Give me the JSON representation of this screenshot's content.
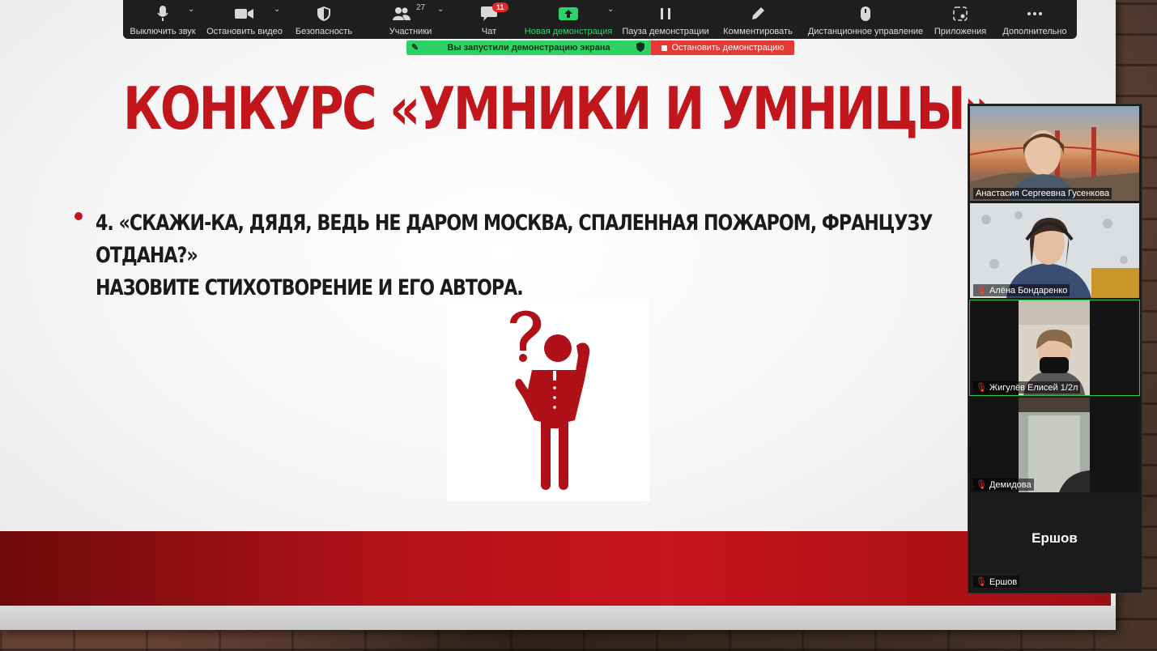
{
  "toolbar": {
    "buttons": [
      {
        "label": "Выключить звук",
        "icon": "microphone-icon"
      },
      {
        "label": "Остановить видео",
        "icon": "video-camera-icon"
      },
      {
        "label": "Безопасность",
        "icon": "shield-icon"
      },
      {
        "label": "Участники",
        "icon": "participants-icon",
        "count": "27"
      },
      {
        "label": "Чат",
        "icon": "chat-icon",
        "badge": "11"
      },
      {
        "label": "Новая демонстрация",
        "icon": "share-screen-icon"
      },
      {
        "label": "Пауза демонстрации",
        "icon": "pause-icon"
      },
      {
        "label": "Комментировать",
        "icon": "pencil-icon"
      },
      {
        "label": "Дистанционное управление",
        "icon": "mouse-icon"
      },
      {
        "label": "Приложения",
        "icon": "apps-icon"
      },
      {
        "label": "Дополнительно",
        "icon": "more-icon"
      }
    ]
  },
  "share_banner": {
    "text": "Вы запустили демонстрацию экрана",
    "stop_label": "Остановить демонстрацию"
  },
  "slide": {
    "title": "КОНКУРС «УМНИКИ И УМНИЦЫ»",
    "bullet_line1": "4. «СКАЖИ-КА, ДЯДЯ, ВЕДЬ НЕ ДАРОМ МОСКВА, СПАЛЕННАЯ ПОЖАРОМ, ФРАНЦУЗУ ОТДАНА?»",
    "bullet_line2": "НАЗОВИТЕ СТИХОТВОРЕНИЕ И ЕГО АВТОРА."
  },
  "participants": [
    {
      "name": "Анастасия Сергеевна Гусенкова",
      "muted": false
    },
    {
      "name": "Алёна Бондаренко",
      "muted": true
    },
    {
      "name": "Жигулёв Елисей 1/2л",
      "muted": true
    },
    {
      "name": "Демидова",
      "muted": true
    },
    {
      "name": "Ершов",
      "muted": true,
      "display_name": "Ершов"
    }
  ],
  "colors": {
    "title_red": "#c0161c",
    "zoom_green": "#2ed164",
    "zoom_red": "#e53935"
  }
}
